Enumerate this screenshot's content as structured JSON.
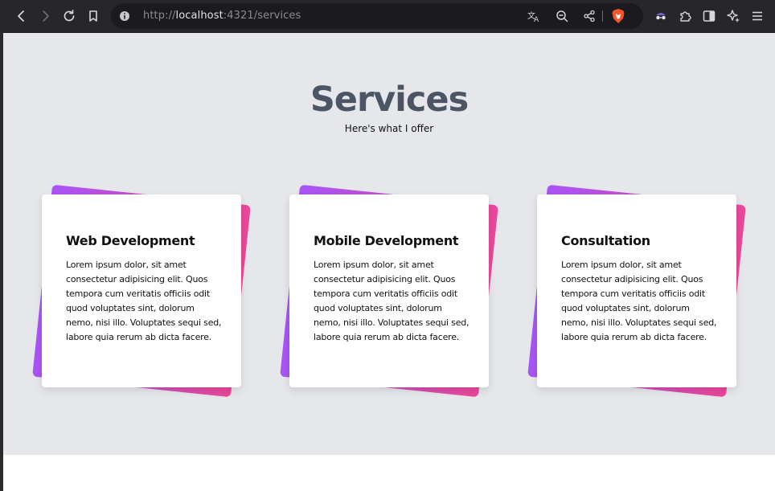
{
  "browser": {
    "url_prefix": "http://",
    "url_host": "localhost",
    "url_rest": ":4321/services"
  },
  "page": {
    "title": "Services",
    "subtitle": "Here's what I offer",
    "cards": [
      {
        "title": "Web Development",
        "body": "Lorem ipsum dolor, sit amet consectetur adipisicing elit. Quos tempora cum veritatis officiis odit quod voluptates sint, dolorum nemo, nisi illo. Voluptates sequi sed, labore quia rerum ab dicta facere."
      },
      {
        "title": "Mobile Development",
        "body": "Lorem ipsum dolor, sit amet consectetur adipisicing elit. Quos tempora cum veritatis officiis odit quod voluptates sint, dolorum nemo, nisi illo. Voluptates sequi sed, labore quia rerum ab dicta facere."
      },
      {
        "title": "Consultation",
        "body": "Lorem ipsum dolor, sit amet consectetur adipisicing elit. Quos tempora cum veritatis officiis odit quod voluptates sint, dolorum nemo, nisi illo. Voluptates sequi sed, labore quia rerum ab dicta facere."
      }
    ]
  },
  "colors": {
    "section_bg": "#e5e7eb",
    "title": "#4b5563",
    "gradient_start": "#a855f7",
    "gradient_end": "#ec4899"
  },
  "icons": [
    "back-icon",
    "forward-icon",
    "reload-icon",
    "bookmark-icon",
    "site-info-icon",
    "translate-icon",
    "zoom-out-icon",
    "share-icon",
    "brave-shields-icon",
    "private-icon",
    "extensions-icon",
    "sidebar-icon",
    "leo-ai-icon",
    "menu-icon"
  ]
}
